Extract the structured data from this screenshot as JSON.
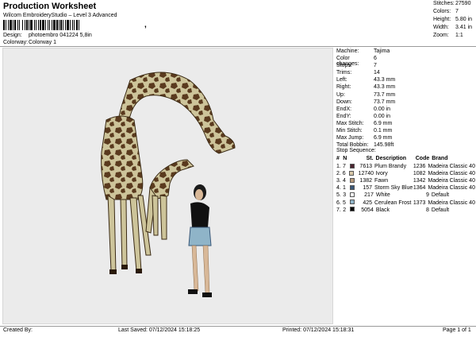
{
  "header": {
    "title": "Production Worksheet",
    "subtitle": "Wilcom EmbroideryStudio – Level 3 Advanced",
    "barcode_suffix": ",",
    "design_label": "Design:",
    "design_value": "photoembro 041224 5,8in",
    "colorway_label": "Colorway:",
    "colorway_value": "Colorway 1"
  },
  "stats": [
    {
      "label": "Stitches:",
      "value": "27590"
    },
    {
      "label": "Colors:",
      "value": "7"
    },
    {
      "label": "Height:",
      "value": "5.80 in"
    },
    {
      "label": "Width:",
      "value": "3.41 in"
    },
    {
      "label": "Zoom:",
      "value": "1:1"
    }
  ],
  "machine_info": [
    {
      "label": "Machine:",
      "value": "Tajima"
    },
    {
      "label": "Color changes:",
      "value": "6"
    },
    {
      "label": "Stops:",
      "value": "7"
    },
    {
      "label": "Trims:",
      "value": "14"
    },
    {
      "label": "Left:",
      "value": "43.3 mm"
    },
    {
      "label": "Right:",
      "value": "43.3 mm"
    },
    {
      "label": "Up:",
      "value": "73.7 mm"
    },
    {
      "label": "Down:",
      "value": "73.7 mm"
    },
    {
      "label": "EndX:",
      "value": "0.00 in"
    },
    {
      "label": "EndY:",
      "value": "0.00 in"
    },
    {
      "label": "Max Stitch:",
      "value": "6.9 mm"
    },
    {
      "label": "Min Stitch:",
      "value": "0.1 mm"
    },
    {
      "label": "Max Jump:",
      "value": "6.9 mm"
    },
    {
      "label": "Total Bobbin:",
      "value": "145.98ft"
    }
  ],
  "stop_sequence": {
    "title": "Stop Sequence:",
    "headers": {
      "idx": "#",
      "stop": "N",
      "st": "St.",
      "desc": "Description",
      "code": "Code",
      "brand": "Brand"
    },
    "rows": [
      {
        "idx": "1.",
        "stop": "7",
        "color": "#4a2430",
        "st": "7613",
        "desc": "Plum Brandy",
        "code": "1236",
        "brand": "Madeira Classic 40"
      },
      {
        "idx": "2.",
        "stop": "6",
        "color": "#d8c8a8",
        "st": "12740",
        "desc": "Ivory",
        "code": "1082",
        "brand": "Madeira Classic 40"
      },
      {
        "idx": "3.",
        "stop": "4",
        "color": "#b89a7c",
        "st": "1382",
        "desc": "Fawn",
        "code": "1342",
        "brand": "Madeira Classic 40"
      },
      {
        "idx": "4.",
        "stop": "1",
        "color": "#3a5878",
        "st": "157",
        "desc": "Storm Sky Blue",
        "code": "1364",
        "brand": "Madeira Classic 40"
      },
      {
        "idx": "5.",
        "stop": "3",
        "color": "#ffffff",
        "st": "217",
        "desc": "White",
        "code": "9",
        "brand": "Default"
      },
      {
        "idx": "6.",
        "stop": "5",
        "color": "#8fb4c8",
        "st": "425",
        "desc": "Cerulean Frost",
        "code": "1373",
        "brand": "Madeira Classic 40"
      },
      {
        "idx": "7.",
        "stop": "2",
        "color": "#0a0a0a",
        "st": "5054",
        "desc": "Black",
        "code": "8",
        "brand": "Default"
      }
    ]
  },
  "footer": {
    "created_by": "Created By:",
    "last_saved": "Last Saved: 07/12/2024 15:18:25",
    "printed": "Printed: 07/12/2024 15:18:31",
    "page": "Page 1 of 1"
  }
}
